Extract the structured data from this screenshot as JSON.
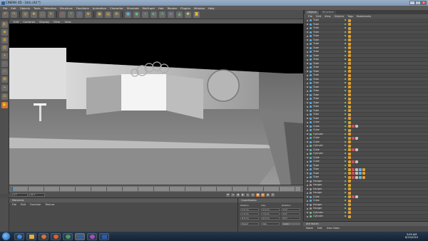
{
  "window": {
    "title": "CINEMA 4D - [dck.c4d *]",
    "controls": [
      "–",
      "▢",
      "✕"
    ]
  },
  "menu": [
    "File",
    "Edit",
    "Objects",
    "Tools",
    "Selection",
    "Structure",
    "Functions",
    "Animation",
    "Character",
    "Simulate",
    "MoGraph",
    "Hair",
    "Render",
    "Plugins",
    "Window",
    "Help"
  ],
  "toolbar": {
    "buttons": [
      "undo-icon",
      "redo-icon",
      "live-select-icon",
      "move-icon",
      "scale-icon",
      "rotate-icon",
      "x-axis-icon",
      "y-axis-icon",
      "z-axis-icon",
      "coord-system-icon",
      "render-view-icon",
      "render-picture-icon",
      "render-settings-icon",
      "cube-icon",
      "sphere-icon",
      "spline-icon",
      "nurbs-icon",
      "array-icon",
      "deformer-icon",
      "scene-icon",
      "light-icon",
      "camera-icon"
    ]
  },
  "viewport": {
    "menu": [
      "Edit",
      "Cameras",
      "Display",
      "Filter",
      "View"
    ]
  },
  "timeline": {
    "labels": [
      "0",
      "5",
      "10",
      "15",
      "20",
      "25",
      "30",
      "35",
      "40",
      "45",
      "50",
      "55",
      "60",
      "65",
      "70",
      "75",
      "80",
      "85",
      "90"
    ]
  },
  "transport": {
    "start": "0 F",
    "end": "90 F",
    "current": "0 F"
  },
  "materials": {
    "title": "Materials",
    "menu": [
      "File",
      "Edit",
      "Function",
      "Texture"
    ]
  },
  "coordinates": {
    "title": "Coordinates",
    "headers": [
      "Position",
      "Size",
      "Rotation"
    ],
    "rows": [
      [
        "X 0 cm",
        "X 0 cm",
        "H 0°"
      ],
      [
        "Y 0 cm",
        "Y 0 cm",
        "P 0°"
      ],
      [
        "Z 0 cm",
        "Z 0 cm",
        "B 0°"
      ]
    ],
    "modes": [
      "Object",
      "Size",
      "Apply"
    ]
  },
  "object_manager": {
    "tabs": [
      "Objects",
      "Structure"
    ],
    "menu": [
      "File",
      "Edit",
      "View",
      "Objects",
      "Tags",
      "Bookmarks"
    ],
    "rows": [
      "Tube",
      "Tube",
      "Tube",
      "Tube",
      "Tube",
      "Tube",
      "Tube",
      "Tube",
      "Tube",
      "Tube",
      "Tube",
      "Tube",
      "Tube",
      "Tube",
      "Tube",
      "Tube",
      "Tube",
      "Tube",
      "Tube",
      "Tube",
      "Tube",
      "Tube",
      "Tube",
      "Tube",
      "Tube",
      "Tube",
      "Cube",
      "Cube",
      "Cube",
      "Cylinder",
      "Cube",
      "Cube",
      "Cylinder",
      "Cube",
      "Cylinder",
      "Cube",
      "Cube",
      "Tube",
      "Tube",
      "Tube",
      "Tube",
      "Hanger",
      "Hanger",
      "Hanger",
      "Hanger",
      "Cube",
      "Cube",
      "Hanger",
      "Hanger",
      "Cylinder",
      "Cylinder"
    ]
  },
  "attributes": {
    "title": "Attributes",
    "menu": [
      "Mode",
      "Edit",
      "User Data"
    ]
  },
  "taskbar": {
    "apps": [
      "ie-icon",
      "explorer-icon",
      "media-icon",
      "firefox-icon",
      "chrome-icon",
      "cinema4d-icon",
      "paint-icon",
      "word-icon"
    ],
    "time": "3:09 AM",
    "date": "6/15/2010"
  }
}
